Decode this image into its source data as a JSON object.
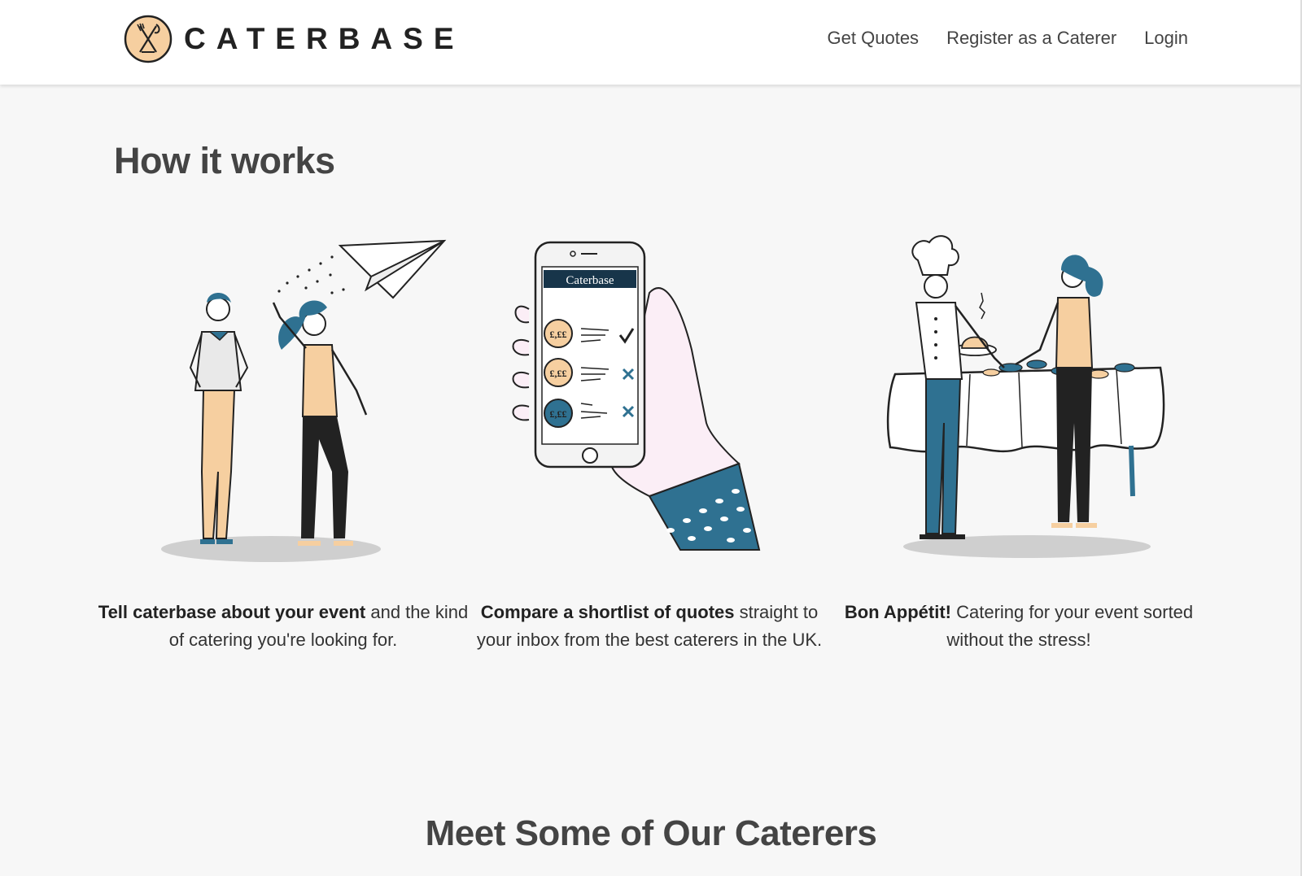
{
  "brand": {
    "name": "CATERBASE"
  },
  "nav": {
    "items": [
      {
        "label": "Get Quotes"
      },
      {
        "label": "Register as a Caterer"
      },
      {
        "label": "Login"
      }
    ]
  },
  "how_it_works": {
    "title": "How it works",
    "steps": [
      {
        "bold": "Tell caterbase about your event",
        "text": " and the kind of catering you're looking for.",
        "illustration": "people-paper-plane"
      },
      {
        "bold": "Compare a shortlist of quotes",
        "text": " straight to your inbox from the best caterers in the UK.",
        "illustration": "phone-quotes",
        "phone_header": "Caterbase",
        "price_badge": "£,££"
      },
      {
        "bold": "Bon Appétit!",
        "text": " Catering for your event sorted without the stress!",
        "illustration": "chef-buffet-table"
      }
    ]
  },
  "caterers": {
    "title": "Meet Some of Our Caterers"
  },
  "colors": {
    "accent_peach": "#f6cfa0",
    "accent_teal": "#2f7191",
    "dark": "#222222",
    "background": "#f7f7f7"
  }
}
